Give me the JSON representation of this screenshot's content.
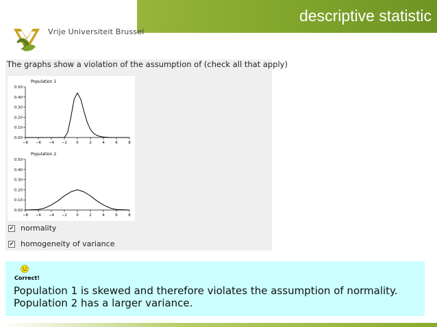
{
  "header": {
    "title": "descriptive statistic",
    "logo_text": "Vrije Universiteit Brussel",
    "brand_color": "#86a92e"
  },
  "quiz": {
    "question": "The graphs show a violation of the assumption of (check all that apply)",
    "options": [
      {
        "label": "normality",
        "checked": true
      },
      {
        "label": "homogeneity of variance",
        "checked": true
      }
    ]
  },
  "chart_data": [
    {
      "type": "line",
      "title": "Population 1",
      "x_ticks": [
        "-8",
        "-6",
        "-4",
        "-2",
        "0",
        "2",
        "4",
        "6",
        "8"
      ],
      "y_ticks": [
        "0.00",
        "0.10",
        "0.20",
        "0.30",
        "0.40",
        "0.50"
      ],
      "xlim": [
        -8,
        8
      ],
      "ylim": [
        0,
        0.5
      ],
      "description_points": {
        "x": [
          -8,
          -2,
          -1.5,
          -1,
          -0.5,
          0,
          0.5,
          1,
          1.5,
          2,
          2.5,
          3,
          3.5,
          4,
          5,
          8
        ],
        "y": [
          0,
          0,
          0.05,
          0.2,
          0.38,
          0.44,
          0.38,
          0.26,
          0.15,
          0.08,
          0.04,
          0.02,
          0.01,
          0.005,
          0,
          0
        ]
      }
    },
    {
      "type": "line",
      "title": "Population 2",
      "x_ticks": [
        "-8",
        "-6",
        "-4",
        "-2",
        "0",
        "2",
        "4",
        "6",
        "8"
      ],
      "y_ticks": [
        "0.00",
        "0.10",
        "0.20",
        "0.30",
        "0.40",
        "0.50"
      ],
      "xlim": [
        -8,
        8
      ],
      "ylim": [
        0,
        0.5
      ],
      "description_points": {
        "x": [
          -8,
          -6,
          -5,
          -4,
          -3,
          -2,
          -1,
          0,
          1,
          2,
          3,
          4,
          5,
          6,
          8
        ],
        "y": [
          0,
          0.005,
          0.02,
          0.05,
          0.09,
          0.14,
          0.18,
          0.2,
          0.18,
          0.14,
          0.09,
          0.05,
          0.02,
          0.005,
          0
        ]
      }
    }
  ],
  "feedback": {
    "status": "Correct!",
    "line1": "Population 1 is skewed and therefore violates the assumption of normality.",
    "line2": "Population 2 has a larger variance.",
    "background": "#ccffff"
  }
}
